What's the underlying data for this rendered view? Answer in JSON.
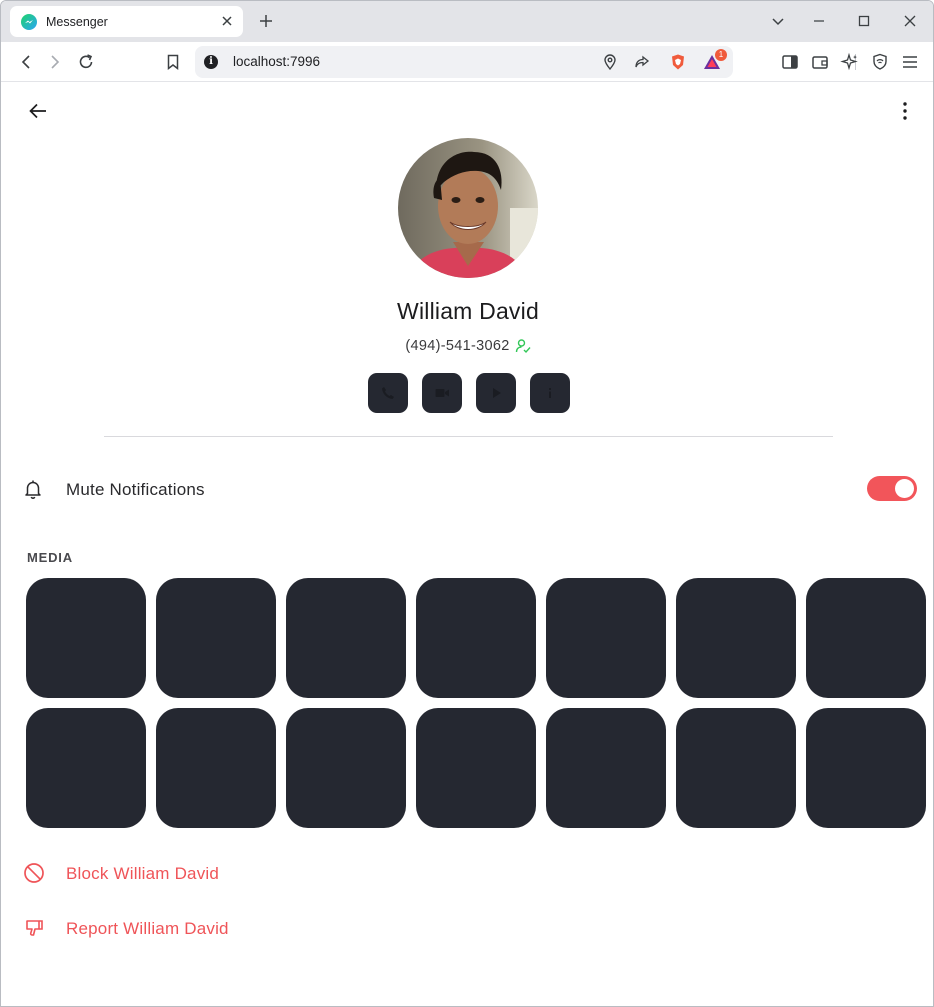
{
  "browser": {
    "tab_title": "Messenger",
    "url": "localhost:7996",
    "brave_rewards_badge": "1"
  },
  "profile": {
    "name": "William David",
    "phone": "(494)-541-3062",
    "avatar_description": "profile-photo"
  },
  "actions": [
    {
      "name": "call-button",
      "icon": "phone-icon"
    },
    {
      "name": "video-call-button",
      "icon": "video-icon"
    },
    {
      "name": "play-button",
      "icon": "play-icon"
    },
    {
      "name": "info-button",
      "icon": "info-icon"
    }
  ],
  "settings": {
    "mute_label": "Mute Notifications",
    "mute_enabled": true
  },
  "media": {
    "label": "MEDIA",
    "tile_count": 14
  },
  "danger_actions": {
    "block_label": "Block William David",
    "report_label": "Report William David"
  },
  "colors": {
    "accent": "#ef5458",
    "tile": "#252831",
    "toggle_on": "#f2555a",
    "online": "#34c759"
  }
}
